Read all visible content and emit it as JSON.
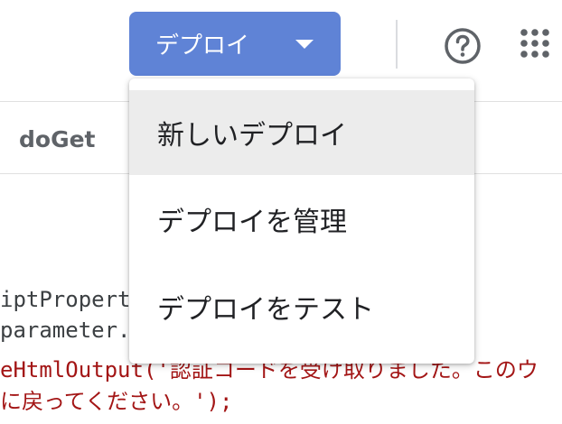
{
  "header": {
    "deploy_button_label": "デプロイ",
    "icons": {
      "dropdown": "chevron-down-icon",
      "help": "help-circle-icon",
      "apps": "apps-grid-icon"
    }
  },
  "tabs": {
    "doget_label": "doGet"
  },
  "code": {
    "line1": "iptPropert",
    "line2": "parameter.",
    "line3": "eHtmlOutput('認証コードを受け取りました。このウ",
    "line4": "に戻ってください。');"
  },
  "deploy_menu": {
    "items": [
      {
        "label": "新しいデプロイ",
        "highlighted": true
      },
      {
        "label": "デプロイを管理",
        "highlighted": false
      },
      {
        "label": "デプロイをテスト",
        "highlighted": false
      }
    ]
  },
  "colors": {
    "deploy_button_bg": "#5f83d6",
    "code_string": "#a31515",
    "menu_hover": "#ececec"
  }
}
